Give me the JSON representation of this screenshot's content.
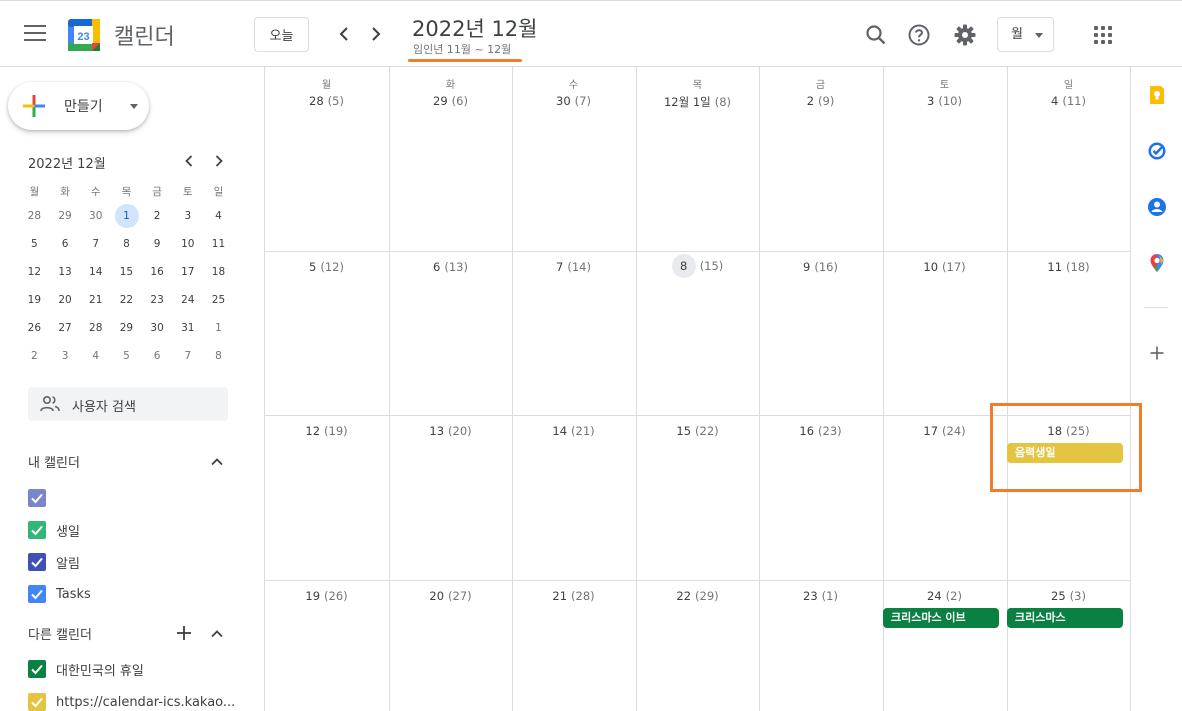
{
  "header": {
    "app_title": "캘린더",
    "logo_day": "23",
    "today_label": "오늘",
    "month_title": "2022년 12월",
    "month_sub": "임인년 11월 ~ 12월",
    "view_label": "월"
  },
  "sidebar": {
    "create_label": "만들기",
    "mini_month_title": "2022년 12월",
    "mini_weekdays": [
      "월",
      "화",
      "수",
      "목",
      "금",
      "토",
      "일"
    ],
    "mini_weeks": [
      [
        "28",
        "29",
        "30",
        "1",
        "2",
        "3",
        "4"
      ],
      [
        "5",
        "6",
        "7",
        "8",
        "9",
        "10",
        "11"
      ],
      [
        "12",
        "13",
        "14",
        "15",
        "16",
        "17",
        "18"
      ],
      [
        "19",
        "20",
        "21",
        "22",
        "23",
        "24",
        "25"
      ],
      [
        "26",
        "27",
        "28",
        "29",
        "30",
        "31",
        "1"
      ],
      [
        "2",
        "3",
        "4",
        "5",
        "6",
        "7",
        "8"
      ]
    ],
    "search_users_label": "사용자 검색",
    "my_calendars_title": "내 캘린더",
    "my_calendars": [
      {
        "label": "",
        "color": "#7986cb"
      },
      {
        "label": "생일",
        "color": "#33b679"
      },
      {
        "label": "알림",
        "color": "#3f51b5"
      },
      {
        "label": "Tasks",
        "color": "#4285f4"
      }
    ],
    "other_calendars_title": "다른 캘린더",
    "other_calendars": [
      {
        "label": "대한민국의 휴일",
        "color": "#0b8043"
      },
      {
        "label": "https://calendar-ics.kakao...",
        "color": "#e4c441"
      }
    ]
  },
  "calendar": {
    "weekdays": [
      "월",
      "화",
      "수",
      "목",
      "금",
      "토",
      "일"
    ],
    "weeks": [
      [
        {
          "day": "28",
          "lunar": "(5)"
        },
        {
          "day": "29",
          "lunar": "(6)"
        },
        {
          "day": "30",
          "lunar": "(7)"
        },
        {
          "day": "12월 1일",
          "lunar": "(8)"
        },
        {
          "day": "2",
          "lunar": "(9)"
        },
        {
          "day": "3",
          "lunar": "(10)"
        },
        {
          "day": "4",
          "lunar": "(11)"
        }
      ],
      [
        {
          "day": "5",
          "lunar": "(12)"
        },
        {
          "day": "6",
          "lunar": "(13)"
        },
        {
          "day": "7",
          "lunar": "(14)"
        },
        {
          "day": "8",
          "lunar": "(15)",
          "today": true
        },
        {
          "day": "9",
          "lunar": "(16)"
        },
        {
          "day": "10",
          "lunar": "(17)"
        },
        {
          "day": "11",
          "lunar": "(18)"
        }
      ],
      [
        {
          "day": "12",
          "lunar": "(19)"
        },
        {
          "day": "13",
          "lunar": "(20)"
        },
        {
          "day": "14",
          "lunar": "(21)"
        },
        {
          "day": "15",
          "lunar": "(22)"
        },
        {
          "day": "16",
          "lunar": "(23)"
        },
        {
          "day": "17",
          "lunar": "(24)"
        },
        {
          "day": "18",
          "lunar": "(25)"
        }
      ],
      [
        {
          "day": "19",
          "lunar": "(26)"
        },
        {
          "day": "20",
          "lunar": "(27)"
        },
        {
          "day": "21",
          "lunar": "(28)"
        },
        {
          "day": "22",
          "lunar": "(29)"
        },
        {
          "day": "23",
          "lunar": "(1)"
        },
        {
          "day": "24",
          "lunar": "(2)"
        },
        {
          "day": "25",
          "lunar": "(3)"
        }
      ]
    ],
    "events": [
      {
        "title": "음력생일",
        "week": 2,
        "col": 6,
        "color": "#e4c441"
      },
      {
        "title": "크리스마스 이브",
        "week": 3,
        "col": 5,
        "color": "#0b8043"
      },
      {
        "title": "크리스마스",
        "week": 3,
        "col": 6,
        "color": "#0b8043"
      }
    ]
  },
  "colors": {
    "accent_blue": "#1a73e8",
    "highlight_orange": "#f07d2d"
  },
  "side_panel": {
    "icons": [
      "keep-icon",
      "tasks-icon",
      "contacts-icon",
      "maps-icon",
      "add-icon"
    ]
  }
}
